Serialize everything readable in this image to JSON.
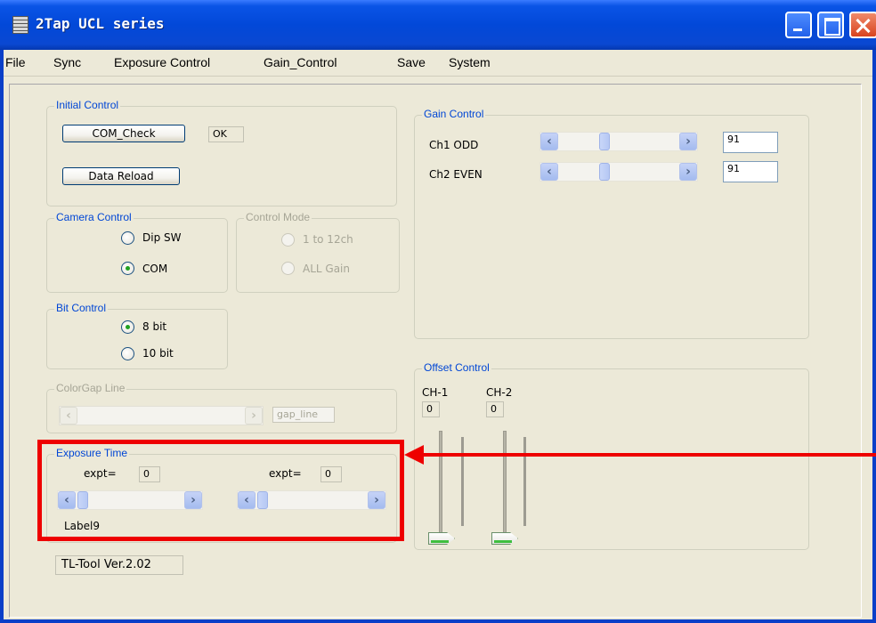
{
  "window": {
    "title": "2Tap UCL series"
  },
  "menu": [
    "File",
    "Sync",
    "Exposure Control",
    "Gain_Control",
    "Save",
    "System"
  ],
  "initial_control": {
    "legend": "Initial Control",
    "com_check_label": "COM_Check",
    "status": "OK",
    "data_reload_label": "Data Reload"
  },
  "camera_control": {
    "legend": "Camera Control",
    "options": [
      "Dip SW",
      "COM"
    ],
    "selected": "COM"
  },
  "control_mode": {
    "legend": "Control Mode",
    "options": [
      "1 to 12ch",
      "ALL Gain"
    ]
  },
  "bit_control": {
    "legend": "Bit Control",
    "options": [
      "8 bit",
      "10 bit"
    ],
    "selected": "8 bit"
  },
  "colorgap": {
    "legend": "ColorGap Line",
    "value": "gap_line"
  },
  "exposure_time": {
    "legend": "Exposure Time",
    "left_label": "expt=",
    "left_value": "0",
    "right_label": "expt=",
    "right_value": "0",
    "footer_label": "Label9"
  },
  "gain_control": {
    "legend": "Gain Control",
    "rows": [
      {
        "label": "Ch1 ODD",
        "value": "91"
      },
      {
        "label": "Ch2 EVEN",
        "value": "91"
      }
    ]
  },
  "offset_control": {
    "legend": "Offset Control",
    "ch1_label": "CH-1",
    "ch1_value": "0",
    "ch2_label": "CH-2",
    "ch2_value": "0"
  },
  "version": "TL-Tool Ver.2.02",
  "icons": {
    "arrow_left": "‹",
    "arrow_right": "›"
  },
  "colors": {
    "titlebar": "#0248d8",
    "highlight": "#ee0000",
    "legend_text": "#0046d5",
    "panel_bg": "#ece9d8"
  }
}
